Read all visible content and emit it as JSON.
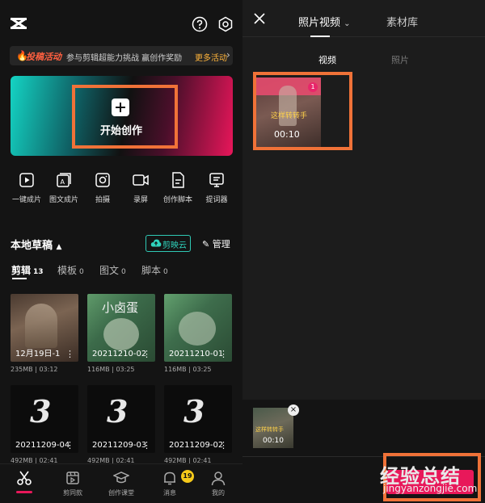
{
  "left": {
    "banner": {
      "flame": "🔥",
      "tag": "投稿活动",
      "message": "参与剪辑超能力挑战 赢创作奖励",
      "more": "更多活动",
      "arrow": "›"
    },
    "create": {
      "label": "开始创作"
    },
    "tools": [
      {
        "label": "一键成片",
        "icon": "one-click-video-icon"
      },
      {
        "label": "图文成片",
        "icon": "text-to-video-icon"
      },
      {
        "label": "拍摄",
        "icon": "camera-icon"
      },
      {
        "label": "录屏",
        "icon": "screen-record-icon"
      },
      {
        "label": "创作脚本",
        "icon": "script-icon"
      },
      {
        "label": "提词器",
        "icon": "teleprompter-icon"
      }
    ],
    "drafts": {
      "title": "本地草稿",
      "cloud": "剪映云",
      "manage": "管理"
    },
    "tabs": [
      {
        "label": "剪辑",
        "count": "13"
      },
      {
        "label": "模板",
        "count": "0"
      },
      {
        "label": "图文",
        "count": "0"
      },
      {
        "label": "脚本",
        "count": "0"
      }
    ],
    "thumbs": [
      {
        "name": "12月19日-1",
        "size": "235MB",
        "duration": "03:12",
        "overlay": ""
      },
      {
        "name": "20211210-02",
        "size": "116MB",
        "duration": "03:25",
        "overlay": "小卤蛋"
      },
      {
        "name": "20211210-01",
        "size": "116MB",
        "duration": "03:25",
        "overlay": ""
      },
      {
        "name": "20211209-04",
        "size": "492MB",
        "duration": "02:41",
        "overlay": "3"
      },
      {
        "name": "20211209-03",
        "size": "492MB",
        "duration": "02:41",
        "overlay": "3"
      },
      {
        "name": "20211209-02",
        "size": "492MB",
        "duration": "02:41",
        "overlay": "3"
      }
    ],
    "nav": [
      {
        "label": "",
        "icon": "scissors-icon"
      },
      {
        "label": "剪同款",
        "icon": "template-icon"
      },
      {
        "label": "创作课堂",
        "icon": "graduation-cap-icon"
      },
      {
        "label": "消息",
        "icon": "bell-icon"
      },
      {
        "label": "我的",
        "icon": "profile-icon"
      }
    ],
    "badge": "19"
  },
  "right": {
    "tab_active": "照片视频",
    "tab_chevron": "⌄",
    "tab_other": "素材库",
    "sub_active": "视频",
    "sub_other": "照片",
    "clip": {
      "index": "1",
      "caption": "这样转转手",
      "duration": "00:10"
    },
    "selected": {
      "caption": "这样转转手",
      "duration": "00:10",
      "remove": "×"
    },
    "watermark": {
      "line1": "经验总结",
      "line2": "jingyanzongjie.com"
    }
  },
  "colors": {
    "accent_red": "#e8185a",
    "teal": "#2fd3bd",
    "highlight": "#f07238",
    "badge_yellow": "#f5c91a"
  }
}
